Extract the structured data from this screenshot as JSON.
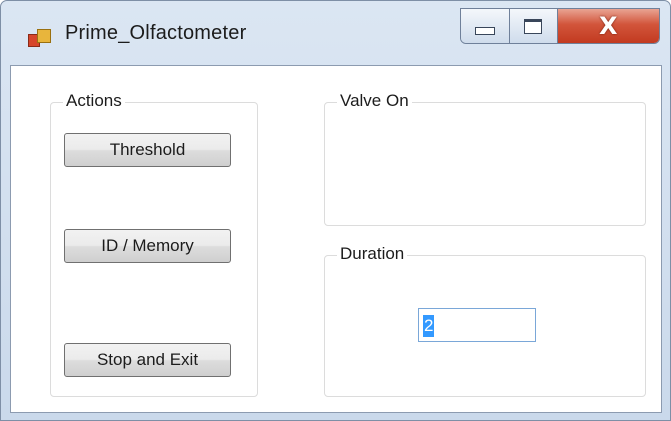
{
  "window": {
    "title": "Prime_Olfactometer",
    "close_glyph": "X",
    "icon": "app-window-icon"
  },
  "actions": {
    "label": "Actions",
    "buttons": {
      "threshold": "Threshold",
      "id_memory": "ID / Memory",
      "stop_exit": "Stop and Exit"
    }
  },
  "valve": {
    "label": "Valve On"
  },
  "duration": {
    "label": "Duration",
    "value": "2"
  },
  "colors": {
    "frame": "#cad9eb",
    "close_button": "#c23a20",
    "selection": "#3399ff",
    "client_bg": "#ffffff"
  }
}
